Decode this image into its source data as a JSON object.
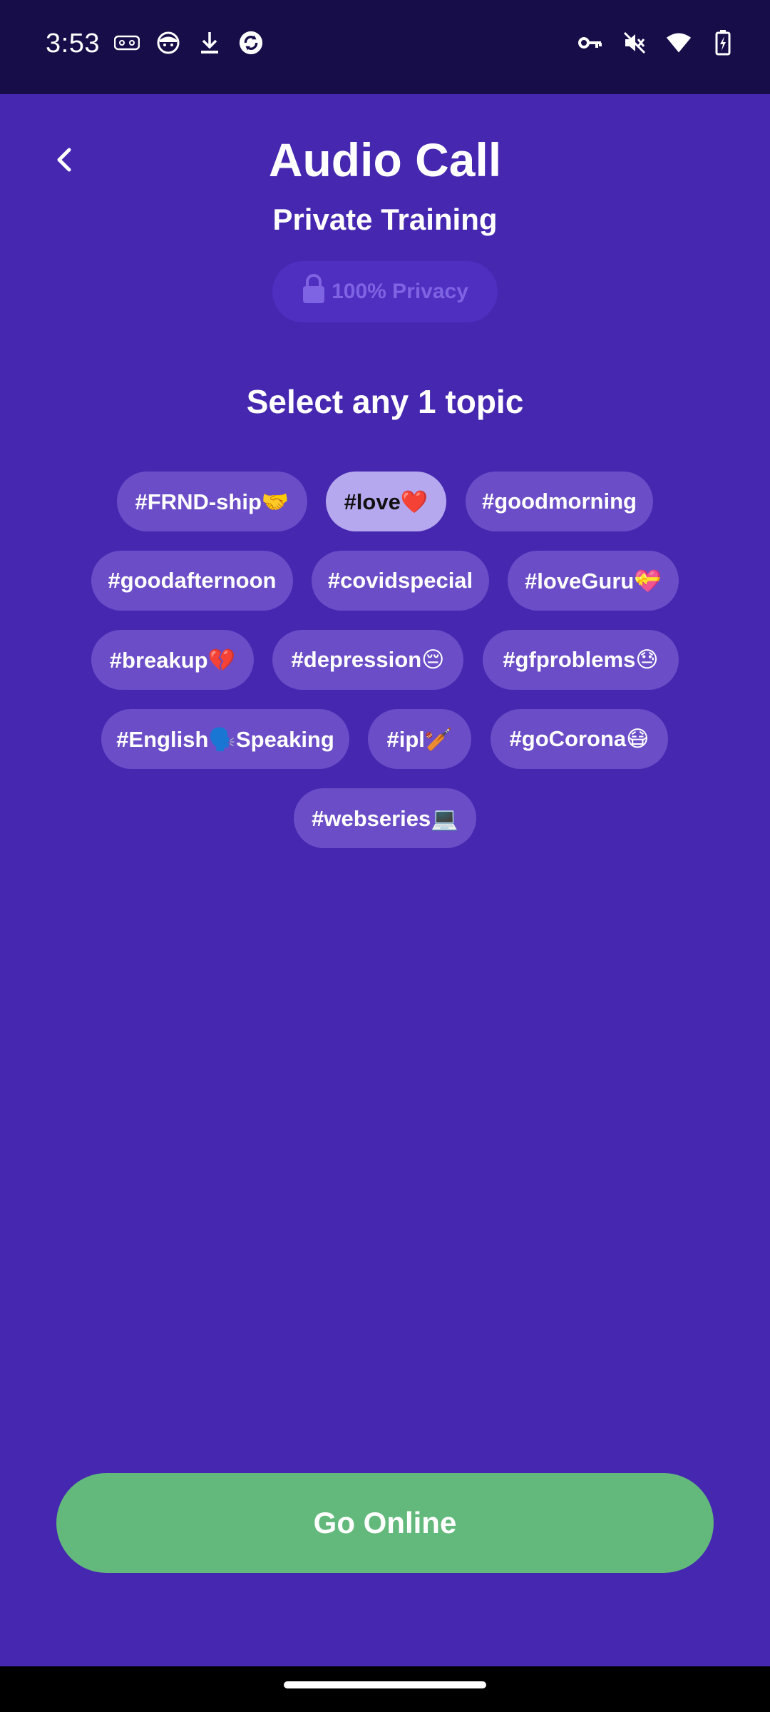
{
  "status_bar": {
    "time": "3:53",
    "left_icons": [
      "tape-icon",
      "face-icon",
      "download-icon",
      "sync-icon"
    ],
    "right_icons": [
      "key-icon",
      "mute-icon",
      "wifi-icon",
      "battery-charging-icon"
    ]
  },
  "header": {
    "title": "Audio Call",
    "subtitle": "Private Training",
    "privacy_label": "100% Privacy"
  },
  "section_title": "Select any 1 topic",
  "topics": [
    {
      "label": "#FRND-ship🤝",
      "selected": false
    },
    {
      "label": "#love❤️",
      "selected": true
    },
    {
      "label": "#goodmorning",
      "selected": false
    },
    {
      "label": "#goodafternoon",
      "selected": false
    },
    {
      "label": "#covidspecial",
      "selected": false
    },
    {
      "label": "#loveGuru💝",
      "selected": false
    },
    {
      "label": "#breakup💔",
      "selected": false
    },
    {
      "label": "#depression😔",
      "selected": false
    },
    {
      "label": "#gfproblems😓",
      "selected": false
    },
    {
      "label": "#English🗣️Speaking",
      "selected": false
    },
    {
      "label": "#ipl🏏",
      "selected": false
    },
    {
      "label": "#goCorona😷",
      "selected": false
    },
    {
      "label": "#webseries💻",
      "selected": false
    }
  ],
  "go_online_label": "Go Online",
  "colors": {
    "background": "#4527B0",
    "status_bar": "#170D49",
    "chip": "#6A4DC7",
    "chip_selected": "#B6A8EE",
    "go_online": "#63B97B"
  }
}
